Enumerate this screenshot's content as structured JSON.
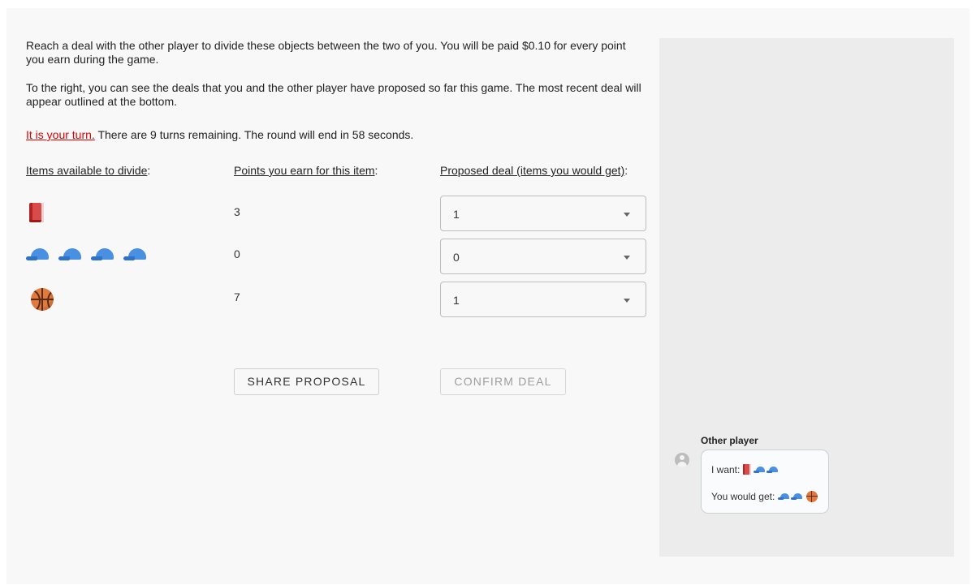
{
  "instructions": {
    "paragraph1": "Reach a deal with the other player to divide these objects between the two of you. You will be paid $0.10 for every point you earn during the game.",
    "paragraph2": "To the right, you can see the deals that you and the other player have proposed so far this game. The most recent deal will appear outlined at the bottom.",
    "turn_notice": "It is your turn.",
    "turn_status": " There are 9 turns remaining. The round will end in 58 seconds."
  },
  "headers": {
    "items": "Items available to divide",
    "points": "Points you earn for this item",
    "proposed": "Proposed deal (items you would get)",
    "colon": ":"
  },
  "items": [
    {
      "icon": "book-icon",
      "count": 1,
      "points": "3",
      "proposed": "1"
    },
    {
      "icon": "cap-icon",
      "count": 4,
      "points": "0",
      "proposed": "0"
    },
    {
      "icon": "basketball-icon",
      "count": 1,
      "points": "7",
      "proposed": "1"
    }
  ],
  "buttons": {
    "share": "SHARE PROPOSAL",
    "confirm": "CONFIRM DEAL"
  },
  "chat": {
    "sender": "Other player",
    "want_label": "I want: ",
    "get_label": "You would get: "
  },
  "colors": {
    "turn_notice": "#e00000",
    "side_panel": "#ececec",
    "background": "#f8f8f8"
  }
}
